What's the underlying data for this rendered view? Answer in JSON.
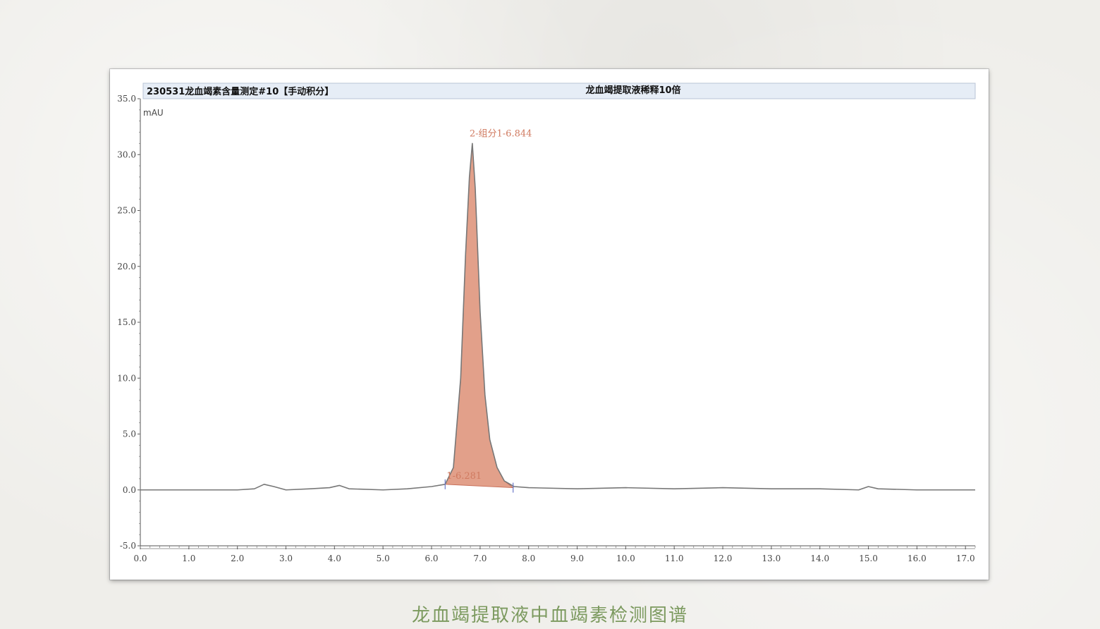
{
  "header": {
    "left_title": "230531龙血竭素含量测定#10【手动积分】",
    "right_title": "龙血竭提取液稀释10倍"
  },
  "caption": "龙血竭提取液中血竭素检测图谱",
  "colors": {
    "trace": "#777777",
    "peak_fill": "#e2a08a",
    "peak_stroke": "#c8705a",
    "annotation": "#d07a60",
    "marker": "#6b78c8",
    "header_band": "#e6edf6",
    "caption": "#7c9a5f"
  },
  "chart_data": {
    "type": "line",
    "title": "",
    "ylabel": "mAU",
    "xlabel": "",
    "xlim": [
      0.0,
      17.2
    ],
    "ylim": [
      -5.0,
      35.0
    ],
    "x_ticks": [
      "0.0",
      "1.0",
      "2.0",
      "3.0",
      "4.0",
      "5.0",
      "6.0",
      "7.0",
      "8.0",
      "9.0",
      "10.0",
      "11.0",
      "12.0",
      "13.0",
      "14.0",
      "15.0",
      "16.0",
      "17.0"
    ],
    "y_ticks": [
      "-5.0",
      "0.0",
      "5.0",
      "10.0",
      "15.0",
      "20.0",
      "25.0",
      "30.0",
      "35.0"
    ],
    "grid": false,
    "series": [
      {
        "x": [
          0.0,
          1.0,
          2.0,
          2.35,
          2.55,
          2.75,
          3.0,
          3.5,
          3.9,
          4.1,
          4.3,
          5.0,
          5.5,
          6.0,
          6.28,
          6.45,
          6.6,
          6.7,
          6.78,
          6.84,
          6.9,
          7.0,
          7.1,
          7.2,
          7.35,
          7.5,
          7.7,
          8.0,
          9.0,
          10.0,
          11.0,
          12.0,
          13.0,
          14.0,
          14.8,
          15.0,
          15.2,
          16.0,
          17.2
        ],
        "y": [
          0.0,
          0.0,
          0.0,
          0.1,
          0.5,
          0.3,
          0.0,
          0.1,
          0.2,
          0.4,
          0.1,
          0.0,
          0.1,
          0.3,
          0.5,
          2.0,
          10.0,
          21.0,
          28.0,
          31.0,
          27.0,
          16.0,
          8.5,
          4.5,
          2.0,
          0.8,
          0.3,
          0.2,
          0.1,
          0.2,
          0.1,
          0.2,
          0.1,
          0.1,
          0.0,
          0.3,
          0.1,
          0.0,
          0.0
        ]
      }
    ],
    "peak_integration": {
      "start": 6.28,
      "end": 7.68
    },
    "annotations": [
      {
        "text": "2-组分1-6.844",
        "x": 6.84,
        "y": 31.0
      },
      {
        "text": "1-6.281",
        "x": 6.28,
        "y": 0.5
      }
    ]
  }
}
